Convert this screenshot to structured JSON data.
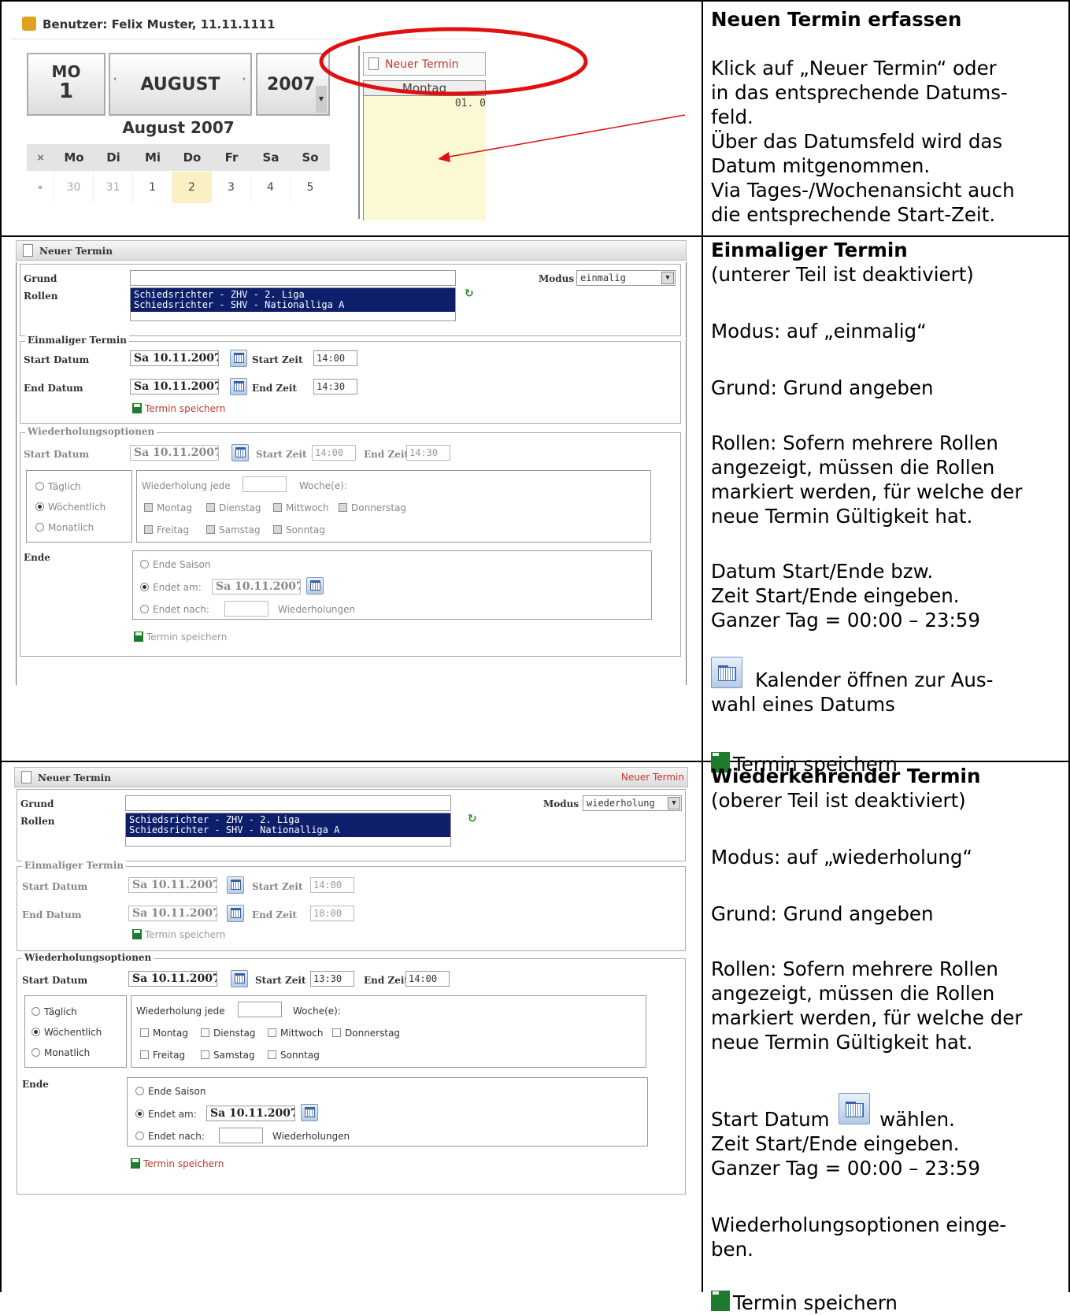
{
  "top": {
    "user": "Benutzer: Felix Muster, 11.11.1111",
    "day_abbr": "MO",
    "day_num": "1",
    "month": "AUGUST",
    "year": "2007",
    "month_year": "August 2007",
    "weekday_headers": [
      "×",
      "Mo",
      "Di",
      "Mi",
      "Do",
      "Fr",
      "Sa",
      "So"
    ],
    "week_row": [
      "»",
      "30",
      "31",
      "1",
      "2",
      "3",
      "4",
      "5"
    ],
    "new_appointment": "Neuer Termin",
    "day_col": "Montag",
    "day_date": "01. 0"
  },
  "row1": {
    "title": "Neuen Termin erfassen",
    "lines": [
      "Klick auf „Neuer Termin“ oder",
      "in das entsprechende Datums-",
      "feld.",
      "Über das Datumsfeld wird das",
      "Datum mitgenommen.",
      "Via Tages-/Wochenansicht auch",
      "die entsprechende Start-Zeit."
    ]
  },
  "row2": {
    "title": "Einmaliger Termin",
    "subtitle": "(unterer Teil ist deaktiviert)",
    "modus": "Modus: auf „einmalig“",
    "grund": "Grund: Grund angeben",
    "rollen_lines": [
      "Rollen: Sofern mehrere Rollen",
      "angezeigt, müssen die Rollen",
      "markiert werden, für welche der",
      "neue Termin Gültigkeit hat."
    ],
    "datum_lines": [
      "Datum Start/Ende bzw.",
      "Zeit Start/Ende eingeben.",
      "Ganzer Tag = 00:00 – 23:59"
    ],
    "cal_lines": [
      "Kalender öffnen zur Aus-",
      "wahl eines Datums"
    ],
    "save": "Termin speichern"
  },
  "row3": {
    "title": "Wiederkehrender Termin",
    "subtitle": "(oberer Teil ist deaktiviert)",
    "modus": "Modus: auf „wiederholung“",
    "grund": "Grund: Grund angeben",
    "rollen_lines": [
      "Rollen: Sofern mehrere Rollen",
      "angezeigt, müssen die Rollen",
      "markiert werden, für welche der",
      "neue Termin Gültigkeit hat."
    ],
    "start_a": "Start Datum",
    "start_b": "wählen.",
    "zeit_lines": [
      "Zeit Start/Ende eingeben.",
      "Ganzer Tag = 00:00 – 23:59"
    ],
    "wied_lines": [
      "Wiederholungsoptionen einge-",
      "ben."
    ],
    "save": "Termin speichern"
  },
  "form": {
    "header": "Neuer Termin",
    "header_link": "Neuer Termin",
    "grund": "Grund",
    "rollen": "Rollen",
    "modus_label": "Modus",
    "modus1": "einmalig",
    "modus2": "wiederholung",
    "role1": "Schiedsrichter - ZHV - 2. Liga",
    "role2": "Schiedsrichter - SHV - Nationalliga A",
    "einmalig_legend": "Einmaliger Termin",
    "start_datum": "Start Datum",
    "end_datum": "End Datum",
    "date": "Sa 10.11.2007",
    "start_zeit": "Start Zeit",
    "end_zeit": "End Zeit",
    "t1400": "14:00",
    "t1430": "14:30",
    "t1800": "18:00",
    "t1330": "13:30",
    "save": "Termin speichern",
    "wied_legend": "Wiederholungsoptionen",
    "taeglich": "Täglich",
    "woechentlich": "Wöchentlich",
    "monatlich": "Monatlich",
    "wied_jede": "Wiederholung jede",
    "wochen": "Woche(e):",
    "days": [
      "Montag",
      "Dienstag",
      "Mittwoch",
      "Donnerstag",
      "Freitag",
      "Samstag",
      "Sonntag"
    ],
    "ende": "Ende",
    "ende_saison": "Ende Saison",
    "endet_am": "Endet am:",
    "endet_nach": "Endet nach:",
    "wiederholungen": "Wiederholungen"
  }
}
